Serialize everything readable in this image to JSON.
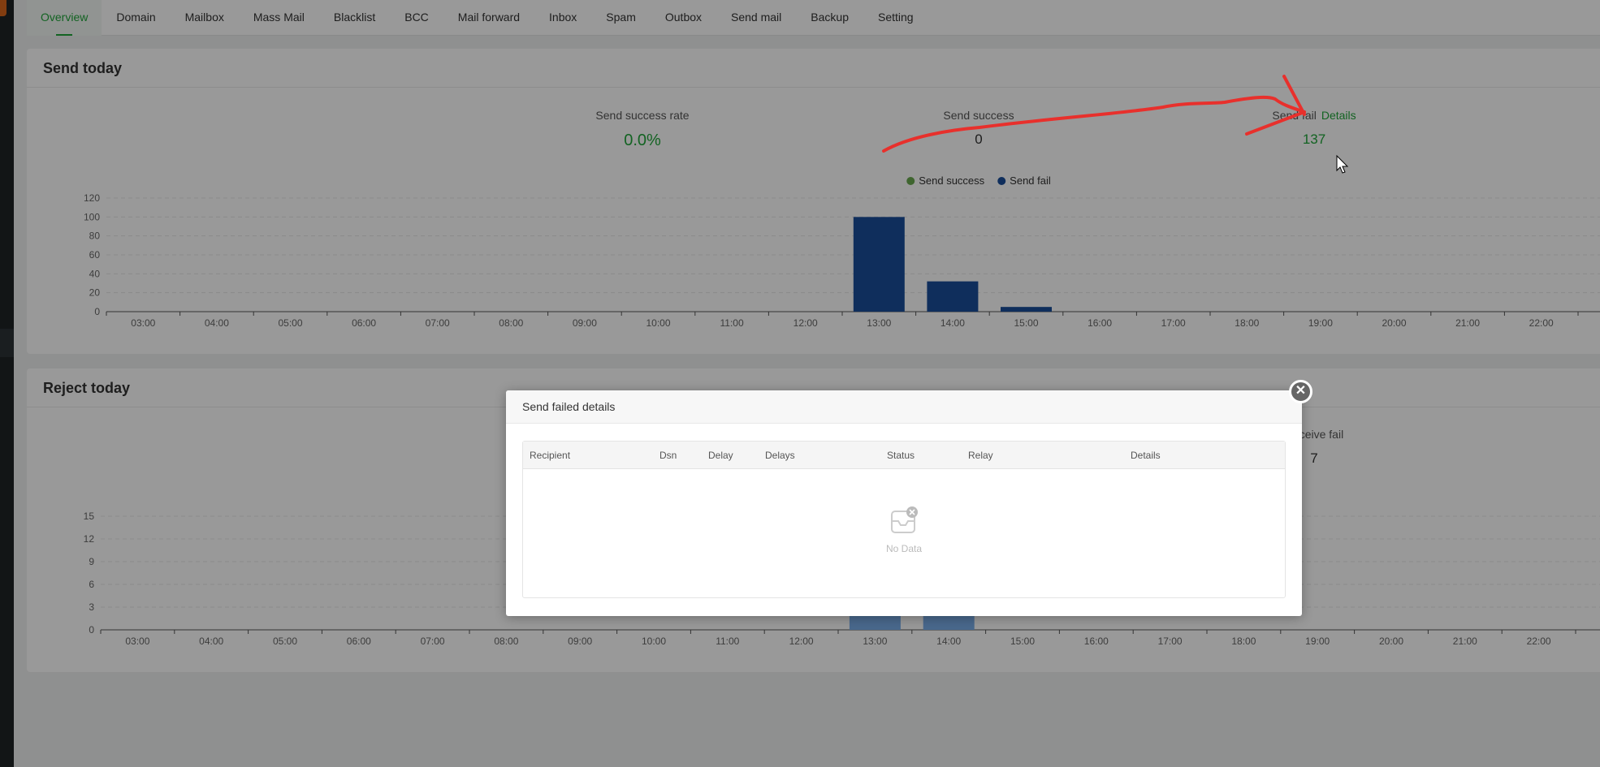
{
  "tabs": [
    "Overview",
    "Domain",
    "Mailbox",
    "Mass Mail",
    "Blacklist",
    "BCC",
    "Mail forward",
    "Inbox",
    "Spam",
    "Outbox",
    "Send mail",
    "Backup",
    "Setting"
  ],
  "active_tab": "Overview",
  "send_today": {
    "title": "Send today",
    "stats": {
      "success_rate_label": "Send success rate",
      "success_rate_value": "0.0%",
      "success_label": "Send success",
      "success_value": "0",
      "fail_label": "Send fail",
      "fail_details_link": "Details",
      "fail_value": "137"
    },
    "legend": [
      "Send success",
      "Send fail"
    ]
  },
  "reject_today": {
    "title": "Reject today",
    "stats": {
      "receive_fail_label": "Receive fail",
      "receive_fail_value": "7"
    }
  },
  "modal": {
    "title": "Send failed details",
    "columns": [
      "Recipient",
      "Dsn",
      "Delay",
      "Delays",
      "Status",
      "Relay",
      "Details"
    ],
    "empty_text": "No Data"
  },
  "colors": {
    "accent": "#20a53a",
    "send_success": "#6aa84f",
    "send_fail": "#194e99",
    "reject": "#7aaeea",
    "annotation": "#e8302c"
  },
  "chart_data": [
    {
      "type": "bar",
      "title": "Send today",
      "categories": [
        "03:00",
        "04:00",
        "05:00",
        "06:00",
        "07:00",
        "08:00",
        "09:00",
        "10:00",
        "11:00",
        "12:00",
        "13:00",
        "14:00",
        "15:00",
        "16:00",
        "17:00",
        "18:00",
        "19:00",
        "20:00",
        "21:00",
        "22:00"
      ],
      "series": [
        {
          "name": "Send success",
          "values": [
            0,
            0,
            0,
            0,
            0,
            0,
            0,
            0,
            0,
            0,
            0,
            0,
            0,
            0,
            0,
            0,
            0,
            0,
            0,
            0
          ]
        },
        {
          "name": "Send fail",
          "values": [
            0,
            0,
            0,
            0,
            0,
            0,
            0,
            0,
            0,
            0,
            100,
            32,
            5,
            0,
            0,
            0,
            0,
            0,
            0,
            0
          ]
        }
      ],
      "yticks": [
        0,
        20,
        40,
        60,
        80,
        100,
        120
      ],
      "ylim": [
        0,
        120
      ],
      "grid": true,
      "legend_position": "top-center"
    },
    {
      "type": "bar",
      "title": "Reject today",
      "categories": [
        "03:00",
        "04:00",
        "05:00",
        "06:00",
        "07:00",
        "08:00",
        "09:00",
        "10:00",
        "11:00",
        "12:00",
        "13:00",
        "14:00",
        "15:00",
        "16:00",
        "17:00",
        "18:00",
        "19:00",
        "20:00",
        "21:00",
        "22:00"
      ],
      "series": [
        {
          "name": "Receive fail",
          "values": [
            0,
            0,
            0,
            0,
            0,
            0,
            0,
            0,
            0,
            0,
            4,
            3,
            0,
            0,
            0,
            0,
            0,
            0,
            0,
            0
          ]
        }
      ],
      "yticks": [
        0,
        3,
        6,
        9,
        12,
        15
      ],
      "ylim": [
        0,
        15
      ],
      "grid": true
    }
  ]
}
